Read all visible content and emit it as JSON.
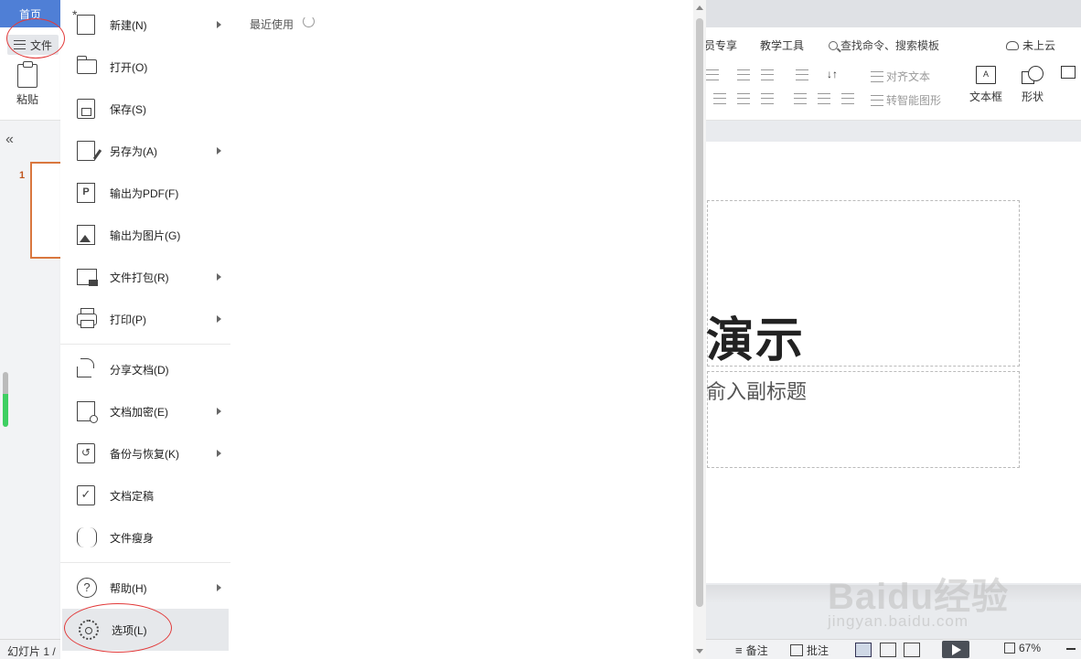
{
  "tabbar": {
    "home_tab": "首页"
  },
  "ribbon": {
    "file_label": "文件",
    "paste_label": "粘贴",
    "tab_member": "员专享",
    "tab_teaching": "教学工具",
    "search_placeholder": "查找命令、搜索模板",
    "cloud_label": "未上云",
    "align_text": "对齐文本",
    "smart_shape": "转智能图形",
    "textbox_label": "文本框",
    "shape_label": "形状"
  },
  "file_menu": {
    "items": [
      {
        "label": "新建(N)",
        "icon": "new-doc-icon",
        "has_submenu": true
      },
      {
        "label": "打开(O)",
        "icon": "folder-icon",
        "has_submenu": false
      },
      {
        "label": "保存(S)",
        "icon": "save-icon",
        "has_submenu": false
      },
      {
        "label": "另存为(A)",
        "icon": "save-as-icon",
        "has_submenu": true
      },
      {
        "label": "输出为PDF(F)",
        "icon": "pdf-icon",
        "has_submenu": false
      },
      {
        "label": "输出为图片(G)",
        "icon": "image-icon",
        "has_submenu": false
      },
      {
        "label": "文件打包(R)",
        "icon": "package-icon",
        "has_submenu": true
      },
      {
        "label": "打印(P)",
        "icon": "printer-icon",
        "has_submenu": true
      },
      {
        "label": "分享文档(D)",
        "icon": "share-icon",
        "has_submenu": false
      },
      {
        "label": "文档加密(E)",
        "icon": "encrypt-icon",
        "has_submenu": true
      },
      {
        "label": "备份与恢复(K)",
        "icon": "backup-icon",
        "has_submenu": true
      },
      {
        "label": "文档定稿",
        "icon": "finalize-icon",
        "has_submenu": false
      },
      {
        "label": "文件瘦身",
        "icon": "slim-icon",
        "has_submenu": false
      },
      {
        "label": "帮助(H)",
        "icon": "help-icon",
        "has_submenu": true
      },
      {
        "label": "选项(L)",
        "icon": "gear-icon",
        "has_submenu": false
      }
    ],
    "hovered_index": 14
  },
  "recent": {
    "title": "最近使用"
  },
  "slides_pane": {
    "slide_number": "1"
  },
  "slide": {
    "title_text": "演示",
    "subtitle_text": "俞入副标题"
  },
  "statusbar": {
    "slide_info": "幻灯片 1 /",
    "notes_label": "备注",
    "comment_label": "批注",
    "zoom": "67%"
  },
  "watermark": {
    "brand": "Baidu经验",
    "url": "jingyan.baidu.com"
  },
  "colors": {
    "accent": "#4f7fd6",
    "annotation": "#e23a3a",
    "thumb_border": "#d9773e"
  }
}
